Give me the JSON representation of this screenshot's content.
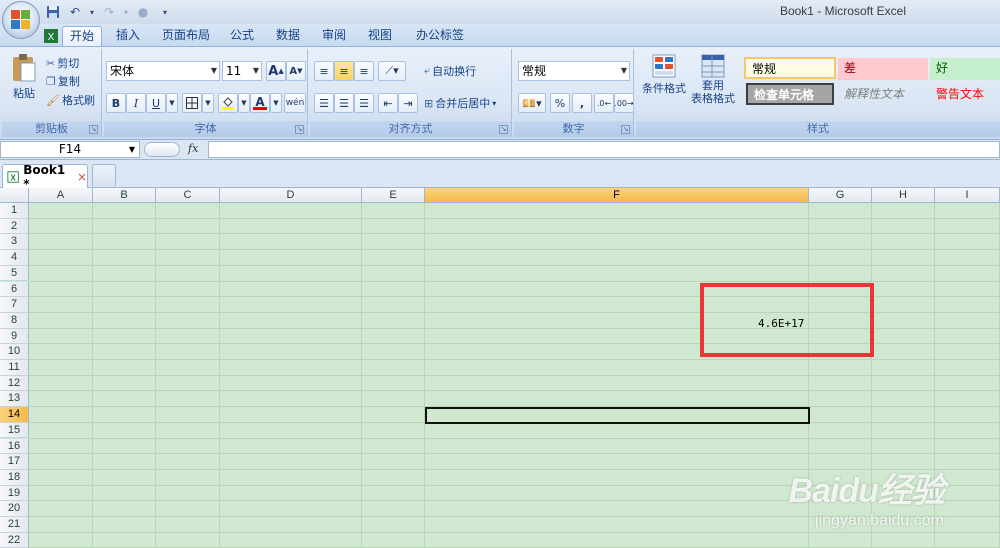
{
  "window": {
    "title": "Book1 - Microsoft Excel"
  },
  "ribbon_tabs": [
    "开始",
    "插入",
    "页面布局",
    "公式",
    "数据",
    "审阅",
    "视图",
    "办公标签"
  ],
  "clipboard": {
    "paste": "粘贴",
    "cut": "剪切",
    "copy": "复制",
    "format_painter": "格式刷",
    "label": "剪贴板"
  },
  "font": {
    "name": "宋体",
    "size": "11",
    "grow": "A",
    "shrink": "A",
    "bold": "B",
    "italic": "I",
    "underline": "U",
    "color_letter": "A",
    "phonetic": "wén",
    "label": "字体"
  },
  "alignment": {
    "wrap_text": "自动换行",
    "merge_center": "合并后居中",
    "label": "对齐方式"
  },
  "number": {
    "format": "常规",
    "percent": "%",
    "comma": ",",
    "label": "数字"
  },
  "styles": {
    "conditional": "条件格式",
    "format_table_line1": "套用",
    "format_table_line2": "表格格式",
    "normal": "常规",
    "bad": "差",
    "good": "好",
    "check_cell": "检查单元格",
    "explanatory": "解释性文本",
    "warning": "警告文本",
    "label": "样式"
  },
  "formula_bar": {
    "name_box": "F14",
    "fx": "fx",
    "content": ""
  },
  "workbook_tab": {
    "name": "Book1 *",
    "close": "×"
  },
  "columns": [
    "A",
    "B",
    "C",
    "D",
    "E",
    "F",
    "G",
    "H",
    "I"
  ],
  "selected_column": "F",
  "rows": [
    "1",
    "2",
    "3",
    "4",
    "5",
    "6",
    "7",
    "8",
    "9",
    "10",
    "11",
    "12",
    "13",
    "14",
    "15",
    "16",
    "17",
    "18",
    "19",
    "20",
    "21",
    "22"
  ],
  "selected_row": "14",
  "cell_g8": {
    "value": "4.6E+17"
  },
  "watermark": {
    "logo": "Baidu经验",
    "url": "jingyan.baidu.com"
  },
  "colors": {
    "highlight": "#e8363b",
    "grid_bg": "#cfe8cf",
    "selected_header": "#f6b94a"
  }
}
